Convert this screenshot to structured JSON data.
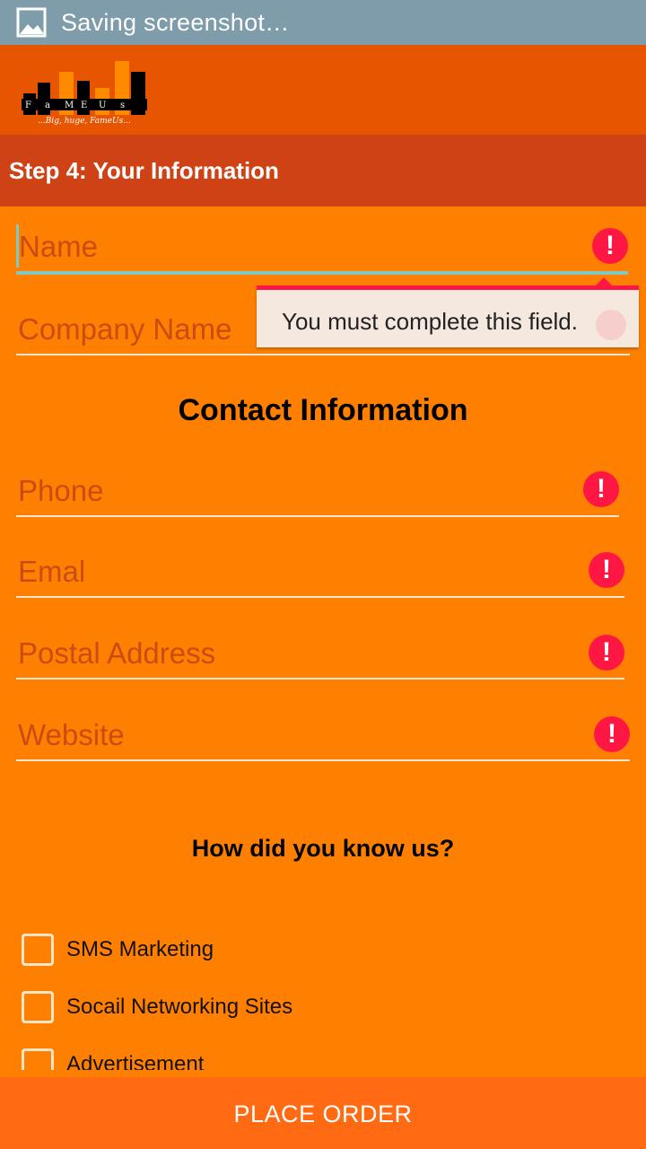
{
  "status_bar": {
    "icon": "image-icon",
    "text": "Saving screenshot…",
    "color": "#7f9caa"
  },
  "app_bar": {
    "color": "#e85500",
    "logo": {
      "letters": [
        "F",
        "a",
        "M",
        "E",
        "U",
        "s"
      ],
      "tagline": "...Big, huge, FameUs..."
    }
  },
  "step_bar": {
    "title": "Step 4: Your Information",
    "color": "#cf4216"
  },
  "fields": {
    "name": {
      "placeholder": "Name",
      "focused": true,
      "error_icon": "alert-icon"
    },
    "company": {
      "placeholder": "Company Name"
    },
    "phone": {
      "placeholder": "Phone",
      "error_icon": "alert-icon"
    },
    "email": {
      "placeholder": "Emal",
      "error_icon": "alert-icon"
    },
    "postal": {
      "placeholder": "Postal Address",
      "error_icon": "alert-icon"
    },
    "website": {
      "placeholder": "Website",
      "error_icon": "alert-icon"
    }
  },
  "error_popup": {
    "message": "You must complete this field.",
    "accent": "#ff1744"
  },
  "contact_heading": "Contact Information",
  "referral": {
    "heading": "How did you know us?",
    "options": [
      {
        "label": "SMS Marketing",
        "checked": false
      },
      {
        "label": "Socail Networking Sites",
        "checked": false
      },
      {
        "label": "Advertisement",
        "checked": false
      }
    ]
  },
  "place_order": {
    "label": "PLACE ORDER",
    "color": "#ff6a12"
  },
  "colors": {
    "background": "#ff8000",
    "placeholder": "#c94c12",
    "error": "#ff1744",
    "focus_line": "#7fc9c2"
  }
}
